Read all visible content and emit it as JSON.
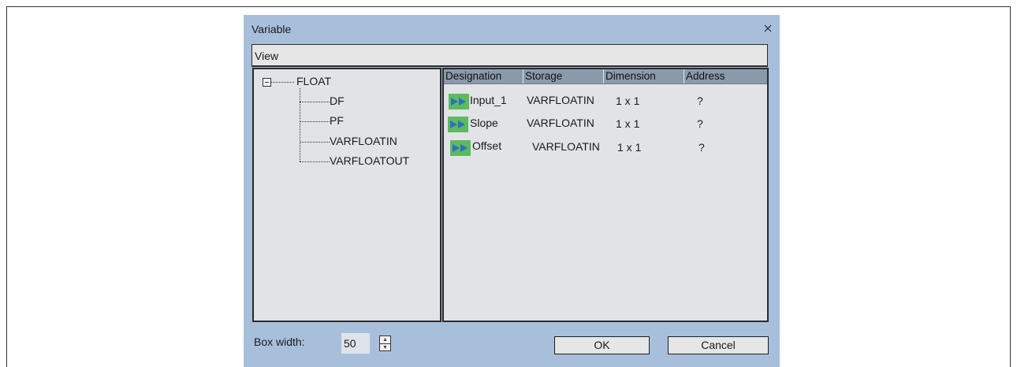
{
  "dialog": {
    "title": "Variable",
    "close_icon": "close-icon",
    "view_label": "View",
    "tree": {
      "root": "FLOAT",
      "children": [
        "DF",
        "PF",
        "VARFLOATIN",
        "VARFLOATOUT"
      ]
    },
    "list": {
      "columns": [
        "Designation",
        "Storage",
        "Dimension",
        "Address"
      ],
      "rows": [
        {
          "designation": "Input_1",
          "storage": "VARFLOATIN",
          "dimension": "1 x 1",
          "address": "?"
        },
        {
          "designation": "Slope",
          "storage": "VARFLOATIN",
          "dimension": "1 x 1",
          "address": "?"
        },
        {
          "designation": "Offset",
          "storage": "VARFLOATIN",
          "dimension": "1 x 1",
          "address": "?"
        }
      ],
      "row_icon": "variable-arrow-icon",
      "row_icon_color": "#5cba5f"
    },
    "box_width": {
      "label": "Box width:",
      "value": "50"
    },
    "buttons": {
      "ok": "OK",
      "cancel": "Cancel"
    },
    "colors": {
      "dialog_bg": "#a8bfdc",
      "panel_bg": "#e1e3e6",
      "header_bg": "#8b9aab"
    }
  }
}
